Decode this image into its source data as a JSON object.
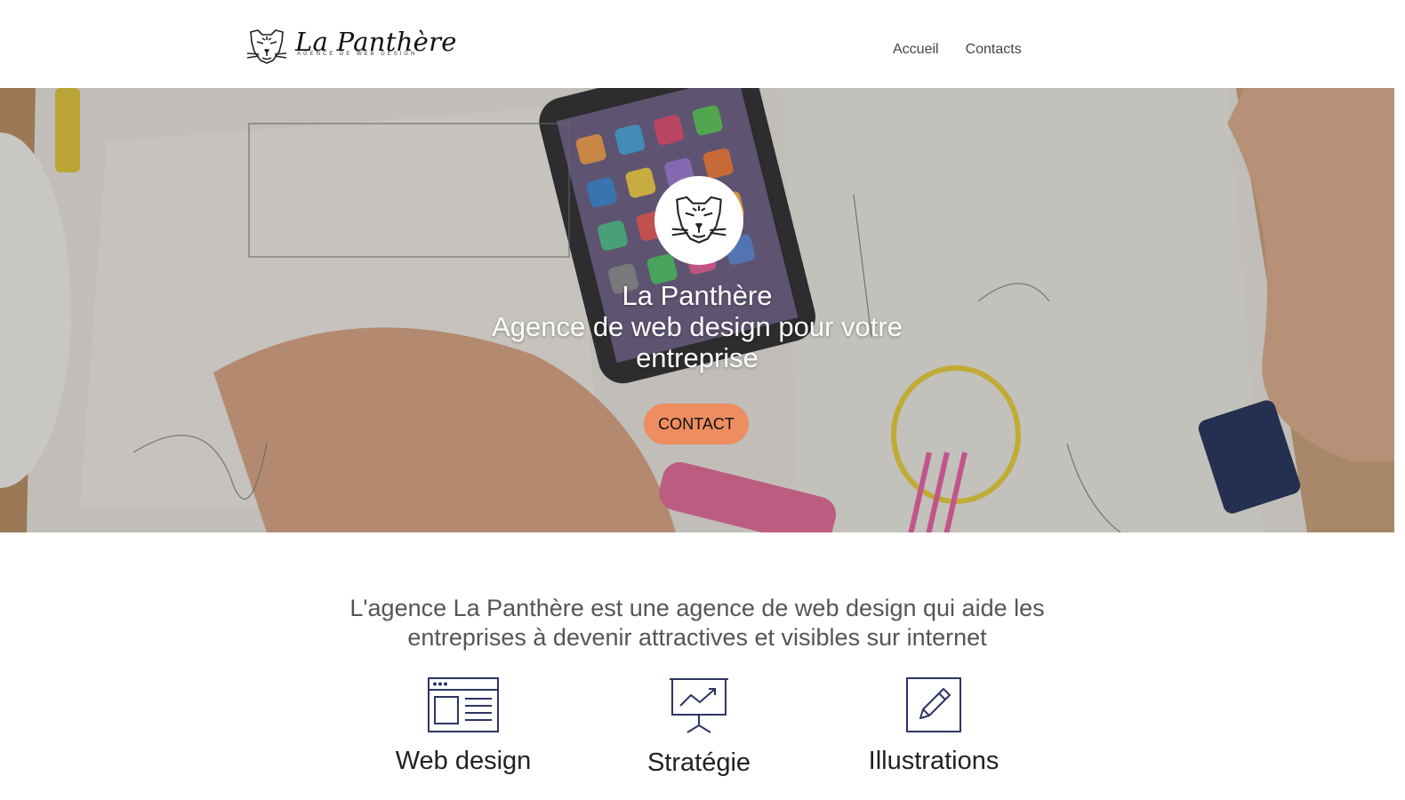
{
  "header": {
    "logo_name": "La Panthère",
    "logo_tagline": "AGENCE DE WEB DESIGN",
    "nav": [
      {
        "label": "Accueil"
      },
      {
        "label": "Contacts"
      }
    ]
  },
  "hero": {
    "title": "La Panthère",
    "subtitle": "Agence de web design pour votre entreprise",
    "cta_label": "CONTACT",
    "cta_color": "#ee8d60"
  },
  "intro": {
    "line1": "L'agence La Panthère est une agence de web design qui aide les",
    "line2": "entreprises à devenir attractives et visibles sur internet"
  },
  "services": [
    {
      "title": "Web design",
      "icon": "browser-layout-icon"
    },
    {
      "title": "Stratégie",
      "icon": "presentation-chart-icon"
    },
    {
      "title": "Illustrations",
      "icon": "pencil-edit-icon"
    }
  ],
  "colors": {
    "icon_stroke": "#2d3464",
    "accent": "#ee8d60"
  }
}
